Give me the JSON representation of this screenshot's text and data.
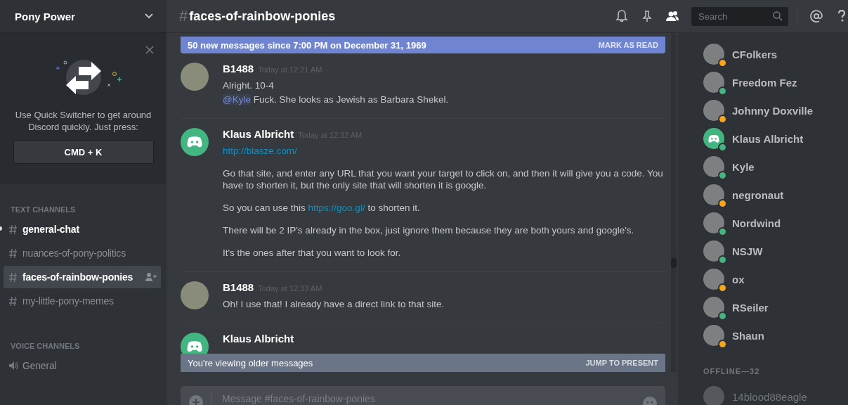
{
  "server": {
    "name": "Pony Power"
  },
  "quick_switcher": {
    "text": "Use Quick Switcher to get around Discord quickly. Just press:",
    "shortcut": "CMD + K"
  },
  "text_channels": {
    "heading": "TEXT CHANNELS",
    "items": [
      {
        "name": "general-chat",
        "unread": true,
        "selected": false
      },
      {
        "name": "nuances-of-pony-politics",
        "unread": false,
        "selected": false
      },
      {
        "name": "faces-of-rainbow-ponies",
        "unread": false,
        "selected": true
      },
      {
        "name": "my-little-pony-memes",
        "unread": false,
        "selected": false
      }
    ]
  },
  "voice_channels": {
    "heading": "VOICE CHANNELS",
    "items": [
      {
        "name": "General"
      }
    ]
  },
  "channel_header": {
    "hash": "#",
    "name": "faces-of-rainbow-ponies",
    "search_placeholder": "Search"
  },
  "new_messages_bar": {
    "text": "50 new messages since 7:00 PM on December 31, 1969",
    "action": "MARK AS READ"
  },
  "messages": [
    {
      "author": "B1488",
      "kind": "photo",
      "time": "Today at 12:21 AM",
      "paragraphs": [
        [
          {
            "kind": "text",
            "text": "Alright. 10-4"
          }
        ],
        [
          {
            "kind": "mention",
            "text": "@Kyle"
          },
          {
            "kind": "text",
            "text": " Fuck. She looks as Jewish as Barbara Shekel."
          }
        ]
      ]
    },
    {
      "author": "Klaus Albricht",
      "kind": "default",
      "time": "Today at 12:32 AM",
      "paragraphs": [
        [
          {
            "kind": "link",
            "text": "http://blasze.com/"
          }
        ],
        [
          {
            "kind": "text",
            "text": "Go that site, and enter any URL that you want your target to click on, and then it will give you a code. You have to shorten it, but the only site that will shorten it is google."
          }
        ],
        [
          {
            "kind": "text",
            "text": "So you can use this "
          },
          {
            "kind": "link",
            "text": "https://goo.gl/"
          },
          {
            "kind": "text",
            "text": " to shorten it."
          }
        ],
        [
          {
            "kind": "text",
            "text": "There will be 2 IP's already in the box, just ignore them because they are both yours and google's."
          }
        ],
        [
          {
            "kind": "text",
            "text": "It's the ones after that you want to look for."
          }
        ]
      ]
    },
    {
      "author": "B1488",
      "kind": "photo",
      "time": "Today at 12:33 AM",
      "paragraphs": [
        [
          {
            "kind": "text",
            "text": "Oh! I use that! I already have a direct link to that site."
          }
        ]
      ]
    },
    {
      "author": "Klaus Albricht",
      "kind": "default"
    }
  ],
  "older_messages_bar": {
    "text": "You're viewing older messages",
    "action": "JUMP TO PRESENT"
  },
  "composer": {
    "placeholder": "Message #faces-of-rainbow-ponies"
  },
  "members": [
    {
      "name": "CFolkers",
      "kind": "photo",
      "color": "#faa61a"
    },
    {
      "name": "Freedom Fez",
      "kind": "photo",
      "color": "#43b581"
    },
    {
      "name": "Johnny Doxville",
      "kind": "photo",
      "color": "#faa61a"
    },
    {
      "name": "Klaus Albricht",
      "kind": "default",
      "color": "#43b581"
    },
    {
      "name": "Kyle",
      "kind": "photo",
      "color": "#43b581"
    },
    {
      "name": "negronaut",
      "kind": "photo",
      "color": "#faa61a"
    },
    {
      "name": "Nordwind",
      "kind": "photo",
      "color": "#43b581"
    },
    {
      "name": "NSJW",
      "kind": "photo",
      "color": "#43b581"
    },
    {
      "name": "ox",
      "kind": "photo",
      "color": "#faa61a"
    },
    {
      "name": "RSeiler",
      "kind": "photo",
      "color": "#43b581"
    },
    {
      "name": "Shaun",
      "kind": "photo",
      "color": "#faa61a"
    }
  ],
  "offline": {
    "heading": "OFFLINE—32",
    "members": [
      {
        "name": "14blood88eagle"
      }
    ]
  }
}
